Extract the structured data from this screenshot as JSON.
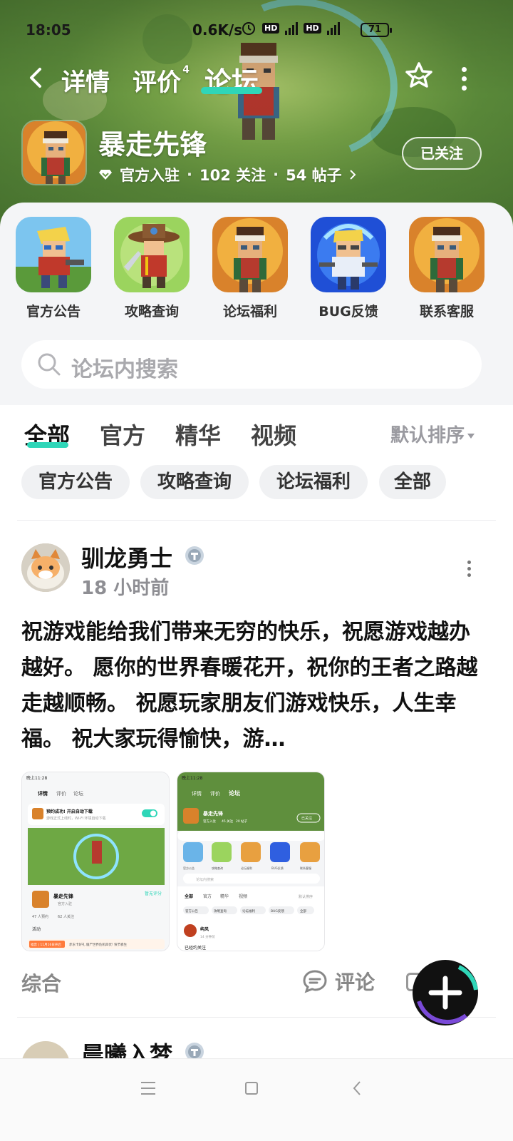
{
  "status_bar": {
    "time": "18:05",
    "net_speed": "0.6K/s",
    "battery": "71"
  },
  "top_nav": {
    "tabs": [
      {
        "label": "详情"
      },
      {
        "label": "评价",
        "badge": "4"
      },
      {
        "label": "论坛"
      }
    ],
    "active_tab": "论坛",
    "accent_color": "#2fd6b8"
  },
  "game": {
    "title": "暴走先锋",
    "verified_label": "官方入驻",
    "followers": "102 关注",
    "posts": "54 帖子",
    "follow_button": "已关注"
  },
  "shortcuts": [
    {
      "label": "官方公告",
      "icon": "hero-blonde-gunner"
    },
    {
      "label": "攻略查询",
      "icon": "cowboy-swordsman"
    },
    {
      "label": "论坛福利",
      "icon": "headband-soldier"
    },
    {
      "label": "BUG反馈",
      "icon": "blue-hero"
    },
    {
      "label": "联系客服",
      "icon": "headband-soldier"
    }
  ],
  "search": {
    "placeholder": "论坛内搜索"
  },
  "feed_tabs": [
    {
      "label": "全部"
    },
    {
      "label": "官方"
    },
    {
      "label": "精华"
    },
    {
      "label": "视频"
    }
  ],
  "active_feed_tab": "全部",
  "sort": {
    "label": "默认排序"
  },
  "chips": [
    {
      "label": "官方公告"
    },
    {
      "label": "攻略查询"
    },
    {
      "label": "论坛福利"
    },
    {
      "label": "全部"
    }
  ],
  "post": {
    "author": "驯龙勇士",
    "time": "18 小时前",
    "content": "祝游戏能给我们带来无穷的快乐，祝愿游戏越办越好。 愿你的世界春暖花开，祝你的王者之路越走越顺畅。 祝愿玩家朋友们游戏快乐，人生幸福。 祝大家玩得愉快，游…",
    "category": "综合",
    "comment_label": "评论",
    "thumbnail_1": {
      "time": "晚上11:28",
      "tabs": [
        "详情",
        "评价",
        "论坛"
      ],
      "notice": "预约成功! 开启自动下载",
      "notice_sub": "游戏正式上线时，Wi-Fi 环境自动下载",
      "game": "暴走先锋",
      "badge": "官方入驻",
      "stats": [
        "47 人预约",
        "62 人关注"
      ],
      "rating_link": "暂无评分",
      "activity": "活动",
      "banner_tag": "福音 | 11月16日开启",
      "banner_text": "赤东卡好礼 僵尸世界危机四伏! 快节奏生"
    },
    "thumbnail_2": {
      "time": "晚上11:28",
      "tabs": [
        "详情",
        "评价",
        "论坛"
      ],
      "game": "暴走先锋",
      "meta": [
        "官方入驻",
        "45 关注",
        "20 帖子"
      ],
      "follow": "已关注",
      "shortcuts": [
        "官方公告",
        "攻略查询",
        "论坛福利",
        "BUG反馈",
        "联系客服"
      ],
      "search": "论坛内搜索",
      "tabs2": [
        "全部",
        "官方",
        "精华",
        "视频"
      ],
      "sort": "默认排序",
      "chips": [
        "官方公告",
        "攻略查询",
        "论坛福利",
        "BUG反馈",
        "全部"
      ],
      "author": "屿风",
      "time_ago": "14 分钟前",
      "snippet": "已经约关注"
    }
  },
  "next_post": {
    "author": "晨曦入梦"
  }
}
